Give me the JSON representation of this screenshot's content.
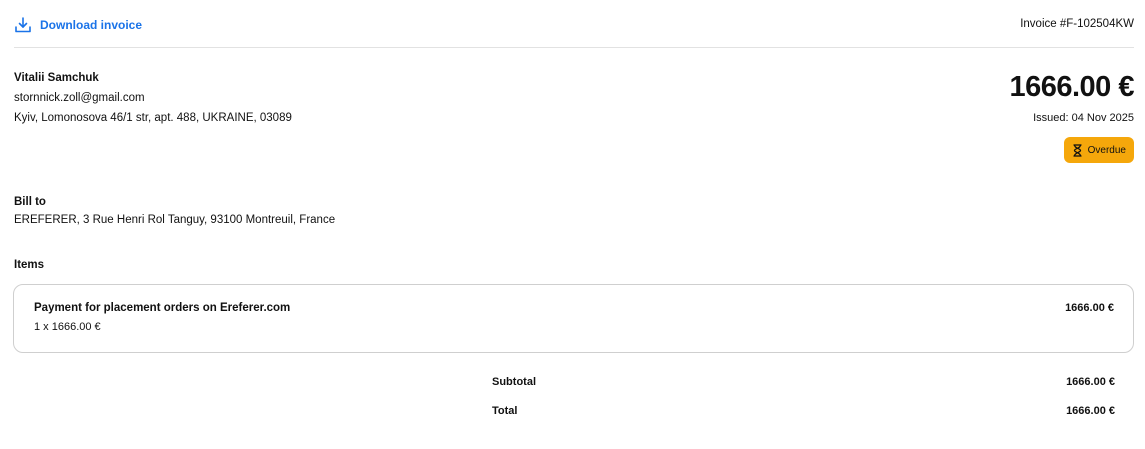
{
  "header": {
    "download_label": "Download invoice",
    "invoice_number": "Invoice #F-102504KW"
  },
  "seller": {
    "name": "Vitalii Samchuk",
    "email": "stornnick.zoll@gmail.com",
    "address": "Kyiv, Lomonosova 46/1 str, apt. 488, UKRAINE, 03089"
  },
  "summary": {
    "total_amount": "1666.00 €",
    "issued": "Issued: 04 Nov 2025",
    "status": "Overdue",
    "status_color": "#f5a70b"
  },
  "bill_to": {
    "label": "Bill to",
    "value": "EREFERER, 3 Rue Henri Rol Tanguy, 93100 Montreuil, France"
  },
  "items": {
    "label": "Items",
    "list": [
      {
        "title": "Payment for placement orders on Ereferer.com",
        "qty": "1 x 1666.00 €",
        "amount": "1666.00 €"
      }
    ]
  },
  "totals": {
    "subtotal_label": "Subtotal",
    "subtotal_value": "1666.00 €",
    "total_label": "Total",
    "total_value": "1666.00 €"
  },
  "accent_color": "#1a73e8"
}
